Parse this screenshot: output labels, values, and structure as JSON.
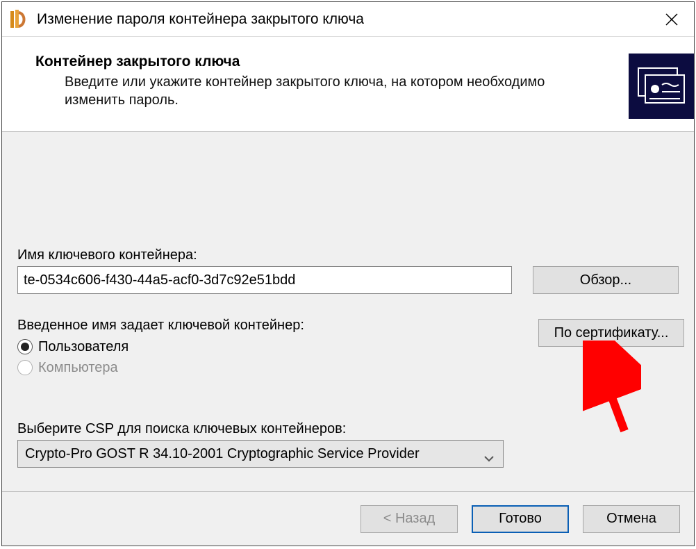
{
  "window": {
    "title": "Изменение пароля контейнера закрытого ключа"
  },
  "header": {
    "title": "Контейнер закрытого ключа",
    "description": "Введите или укажите контейнер закрытого ключа, на котором необходимо изменить пароль."
  },
  "container_name": {
    "label": "Имя ключевого контейнера:",
    "value": "te-0534c606-f430-44a5-acf0-3d7c92e51bdd",
    "browse_button": "Обзор..."
  },
  "scope": {
    "label": "Введенное имя задает ключевой контейнер:",
    "options": {
      "user": "Пользователя",
      "computer": "Компьютера"
    },
    "selected": "user",
    "by_cert_button": "По сертификату..."
  },
  "csp": {
    "label": "Выберите CSP для поиска ключевых контейнеров:",
    "selected": "Crypto-Pro GOST R 34.10-2001 Cryptographic Service Provider"
  },
  "footer": {
    "back": "< Назад",
    "finish": "Готово",
    "cancel": "Отмена"
  }
}
